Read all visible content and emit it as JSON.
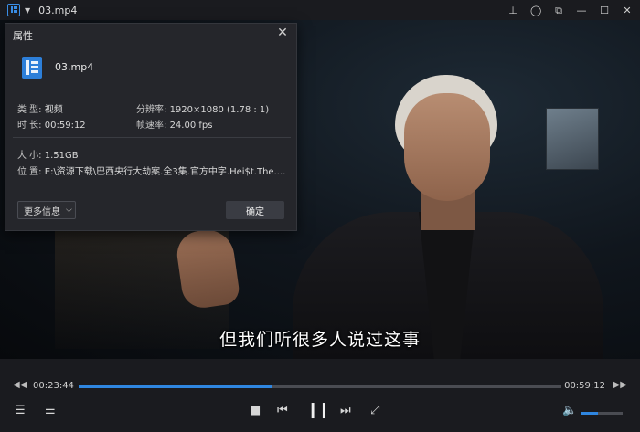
{
  "window": {
    "title": "03.mp4",
    "caret_icon": "chevron-down-icon",
    "controls": [
      "pin-icon",
      "location-icon",
      "restore-icon",
      "minimize-icon",
      "maximize-icon",
      "close-icon"
    ]
  },
  "video": {
    "subtitle": "但我们听很多人说过这事"
  },
  "dialog": {
    "title": "属性",
    "filename": "03.mp4",
    "type_label": "类 型:",
    "type_value": "视频",
    "resolution_label": "分辨率:",
    "resolution_value": "1920×1080 (1.78 : 1)",
    "duration_label": "时 长:",
    "duration_value": "00:59:12",
    "framerate_label": "帧速率:",
    "framerate_value": "24.00 fps",
    "size_label": "大 小:",
    "size_value": "1.51GB",
    "location_label": "位 置:",
    "location_value": "E:\\资源下载\\巴西央行大劫案.全3集.官方中字.Hei$t.The....",
    "more_info": "更多信息",
    "ok": "确定"
  },
  "playback": {
    "current_time": "00:23:44",
    "total_time": "00:59:12",
    "progress_fraction": 0.401,
    "volume_fraction": 0.4
  },
  "colors": {
    "accent": "#2f86e0",
    "bar_bg": "#1a1b1f",
    "dialog_bg": "#25262b"
  }
}
